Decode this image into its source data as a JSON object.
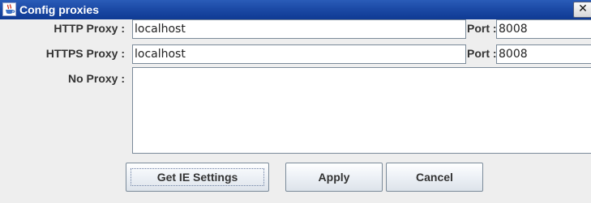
{
  "window": {
    "title": "Config proxies",
    "close_glyph": "✕"
  },
  "form": {
    "http_proxy": {
      "label": "HTTP  Proxy :",
      "value": "localhost",
      "port_label": "Port :",
      "port_value": "8008"
    },
    "https_proxy": {
      "label": "HTTPS Proxy :",
      "value": "localhost",
      "port_label": "Port :",
      "port_value": "8008"
    },
    "no_proxy": {
      "label": "No Proxy :",
      "value": ""
    }
  },
  "buttons": {
    "get_ie_settings": "Get IE Settings",
    "apply": "Apply",
    "cancel": "Cancel"
  },
  "icons": {
    "app": "java-cup-icon",
    "close": "close-icon"
  }
}
